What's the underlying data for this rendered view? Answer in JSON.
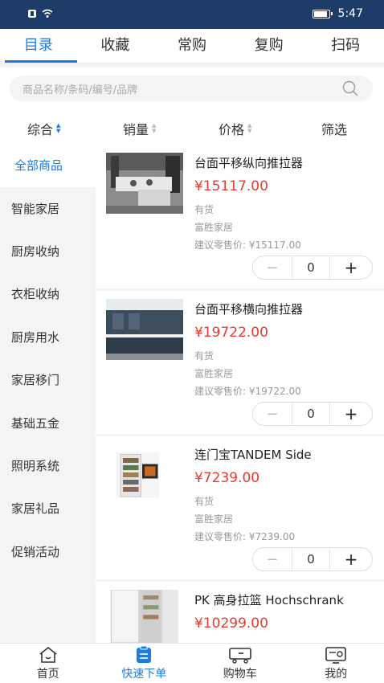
{
  "status": {
    "time": "5:47"
  },
  "top_tabs": [
    "目录",
    "收藏",
    "常购",
    "复购",
    "扫码"
  ],
  "search": {
    "placeholder": "商品名称/条码/编号/品牌"
  },
  "sort": {
    "comprehensive": "综合",
    "sales": "销量",
    "price": "价格",
    "filter": "筛选"
  },
  "sidebar": [
    "全部商品",
    "智能家居",
    "厨房收纳",
    "衣柜收纳",
    "厨房用水",
    "家居移门",
    "基础五金",
    "照明系统",
    "家居礼品",
    "促销活动"
  ],
  "products": [
    {
      "title": "台面平移纵向推拉器",
      "price": "¥15117.00",
      "stock": "有货",
      "brand": "富胜家居",
      "retail": "建议零售价: ¥15117.00",
      "qty": "0"
    },
    {
      "title": "台面平移横向推拉器",
      "price": "¥19722.00",
      "stock": "有货",
      "brand": "富胜家居",
      "retail": "建议零售价: ¥19722.00",
      "qty": "0"
    },
    {
      "title": "连门宝TANDEM Side",
      "price": "¥7239.00",
      "stock": "有货",
      "brand": "富胜家居",
      "retail": "建议零售价: ¥7239.00",
      "qty": "0"
    },
    {
      "title": "PK 高身拉篮 Hochschrank",
      "price": "¥10299.00"
    }
  ],
  "stepper": {
    "minus": "−",
    "plus": "+"
  },
  "bottom_nav": [
    "首页",
    "快速下单",
    "购物车",
    "我的"
  ],
  "colors": {
    "accent": "#1e7be0",
    "price": "#e83a2e",
    "status_bar": "#1d3c6a"
  }
}
